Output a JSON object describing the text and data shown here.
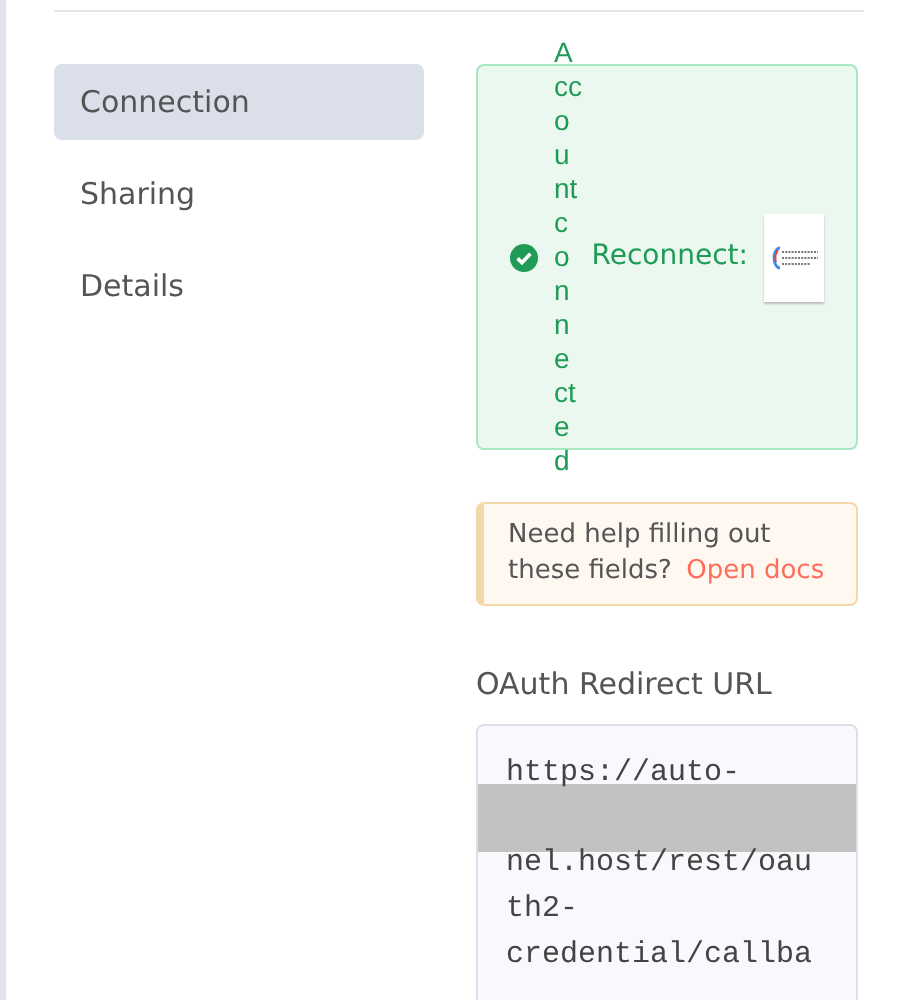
{
  "sidebar": {
    "items": [
      {
        "label": "Connection",
        "selected": true
      },
      {
        "label": "Sharing",
        "selected": false
      },
      {
        "label": "Details",
        "selected": false
      }
    ]
  },
  "status": {
    "connected": true,
    "text": "Account connected",
    "reconnect_label": "Reconnect:"
  },
  "help": {
    "text": "Need help filling out these fields?",
    "link": "Open docs"
  },
  "redirect_url": {
    "label": "OAuth Redirect URL",
    "lines": [
      {
        "kind": "text",
        "text": "https://auto-"
      },
      {
        "kind": "redacted"
      },
      {
        "kind": "text",
        "text": "nel.host/rest/oau"
      },
      {
        "kind": "text",
        "text": "th2-"
      },
      {
        "kind": "text",
        "text": "credential/callba"
      }
    ]
  }
}
